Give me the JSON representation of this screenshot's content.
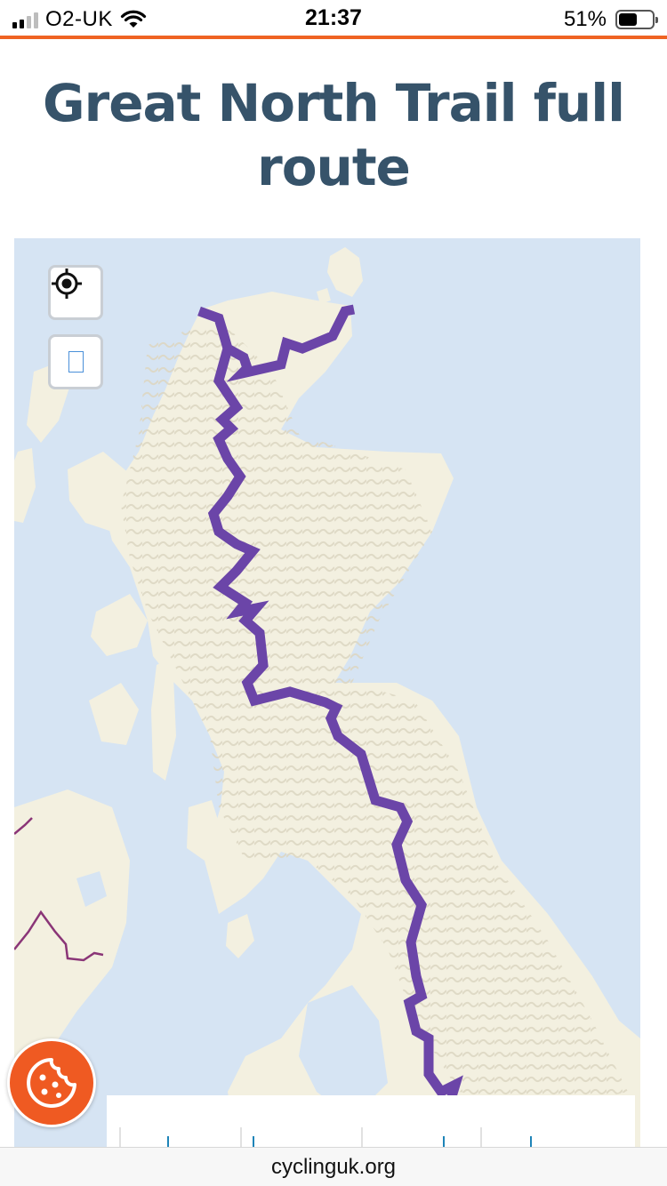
{
  "status_bar": {
    "carrier": "O2-UK",
    "time": "21:37",
    "battery": "51%",
    "battery_level": 0.51,
    "signal_bars": 2,
    "signal_bars_total": 4
  },
  "page": {
    "title": "Great North Trail full route",
    "accent_color": "#ef6322",
    "title_color": "#36536a"
  },
  "map": {
    "controls": [
      {
        "name": "locate-control",
        "icon": "crosshair-target-icon"
      },
      {
        "name": "fullscreen-control",
        "icon": "square-outline-icon"
      }
    ],
    "route_color": "#6b45a8",
    "water_color": "#d6e4f3",
    "land_color": "#f3f0e0",
    "border_color": "#8a3577"
  },
  "cookie_button": {
    "icon": "cookie-icon",
    "color": "#ef5a22"
  },
  "address_bar": {
    "url": "cyclinguk.org"
  }
}
